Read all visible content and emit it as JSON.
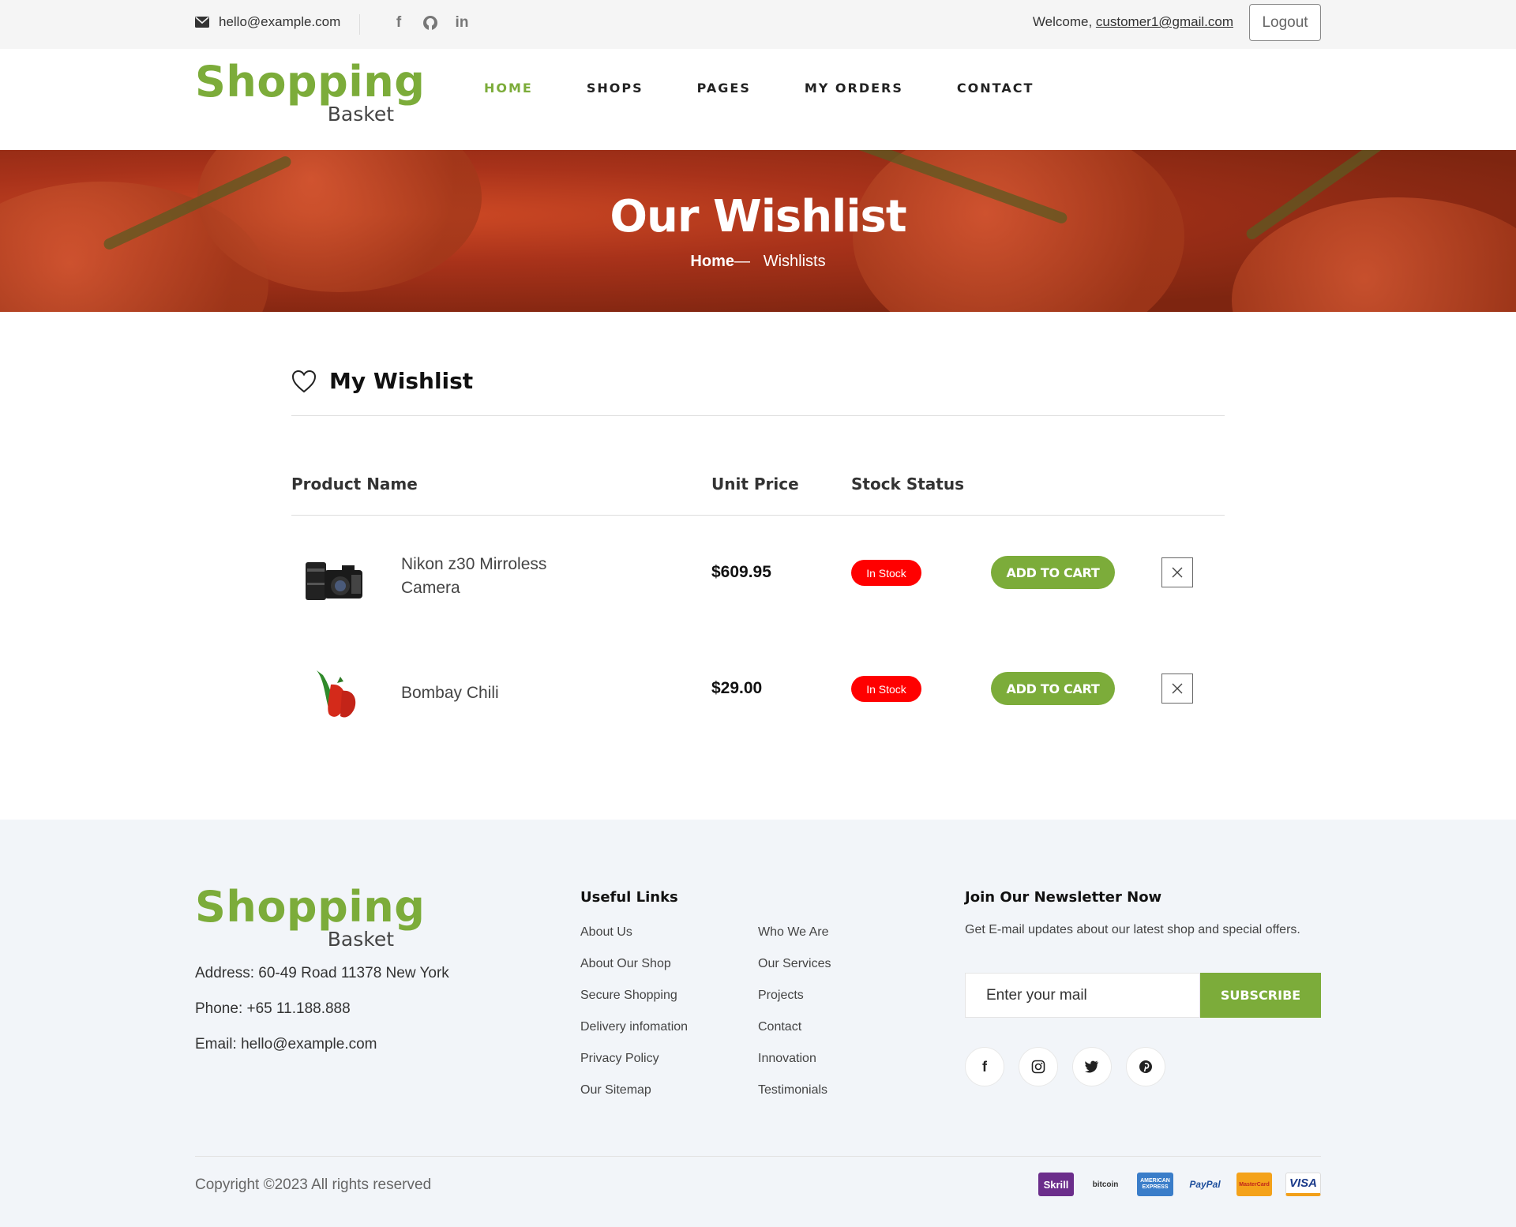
{
  "topbar": {
    "email": "hello@example.com",
    "welcome_prefix": "Welcome, ",
    "user_email": "customer1@gmail.com",
    "logout_label": "Logout",
    "social_icons": [
      "facebook-icon",
      "github-icon",
      "linkedin-icon"
    ]
  },
  "brand": {
    "line1": "Shopping",
    "line2": "Basket",
    "color": "#7cac3a"
  },
  "nav": {
    "items": [
      {
        "label": "HOME",
        "active": true
      },
      {
        "label": "SHOPS"
      },
      {
        "label": "PAGES"
      },
      {
        "label": "MY ORDERS"
      },
      {
        "label": "CONTACT"
      }
    ]
  },
  "banner": {
    "title": "Our Wishlist",
    "crumb_home": "Home",
    "crumb_sep": "— ",
    "crumb_current": "Wishlists"
  },
  "wishlist": {
    "title": "My Wishlist",
    "headers": {
      "product": "Product Name",
      "price": "Unit Price",
      "stock": "Stock Status"
    },
    "items": [
      {
        "name": "Nikon z30 Mirroless Camera",
        "price": "$609.95",
        "stock": "In Stock",
        "action": "ADD TO CART"
      },
      {
        "name": "Bombay Chili",
        "price": "$29.00",
        "stock": "In Stock",
        "action": "ADD TO CART"
      }
    ],
    "colors": {
      "badge": "#ff0000",
      "button": "#7cac3a"
    }
  },
  "footer": {
    "address": "Address: 60-49 Road 11378 New York",
    "phone": "Phone: +65 11.188.888",
    "email": "Email: hello@example.com",
    "useful_links_title": "Useful Links",
    "links_col1": [
      "About Us",
      "About Our Shop",
      "Secure Shopping",
      "Delivery infomation",
      "Privacy Policy",
      "Our Sitemap"
    ],
    "links_col2": [
      "Who We Are",
      "Our Services",
      "Projects",
      "Contact",
      "Innovation",
      "Testimonials"
    ],
    "newsletter_title": "Join Our Newsletter Now",
    "newsletter_desc": "Get E-mail updates about our latest shop and special offers.",
    "input_placeholder": "Enter your mail",
    "subscribe_label": "SUBSCRIBE",
    "social_icons": [
      "facebook-icon",
      "instagram-icon",
      "twitter-icon",
      "pinterest-icon"
    ],
    "copyright": "Copyright ©2023 All rights reserved",
    "payments": [
      "Skrill",
      "bitcoin",
      "AMERICAN EXPRESS",
      "PayPal",
      "MasterCard",
      "VISA"
    ]
  }
}
